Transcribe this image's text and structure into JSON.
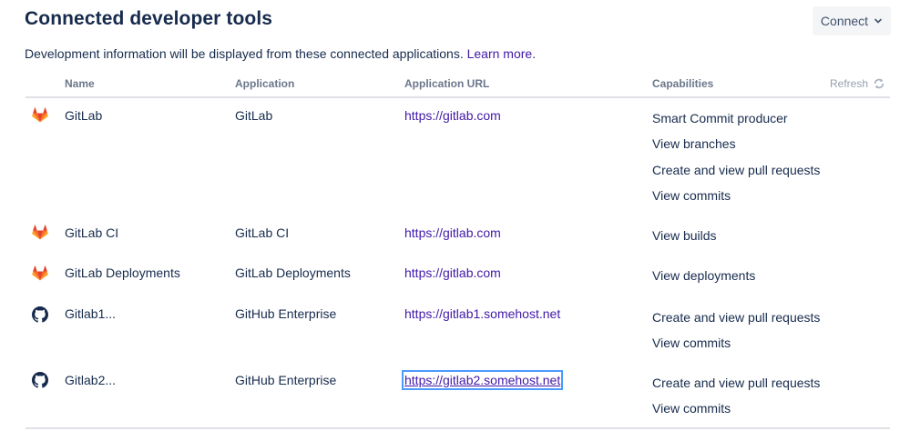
{
  "header": {
    "title": "Connected developer tools",
    "connect_label": "Connect",
    "description_text": "Development information will be displayed from these connected applications.",
    "learn_more": "Learn more",
    "learn_more_suffix": "."
  },
  "table": {
    "columns": {
      "name": "Name",
      "application": "Application",
      "url": "Application URL",
      "capabilities": "Capabilities"
    },
    "refresh_label": "Refresh",
    "rows": [
      {
        "icon": "gitlab-icon",
        "name": "GitLab",
        "application": "GitLab",
        "url": "https://gitlab.com",
        "capabilities": [
          "Smart Commit producer",
          "View branches",
          "Create and view pull requests",
          "View commits"
        ]
      },
      {
        "icon": "gitlab-icon",
        "name": "GitLab CI",
        "application": "GitLab CI",
        "url": "https://gitlab.com",
        "capabilities": [
          "View builds"
        ]
      },
      {
        "icon": "gitlab-icon",
        "name": "GitLab Deployments",
        "application": "GitLab Deployments",
        "url": "https://gitlab.com",
        "capabilities": [
          "View deployments"
        ]
      },
      {
        "icon": "github-icon",
        "name": "Gitlab1...",
        "application": "GitHub Enterprise",
        "url": "https://gitlab1.somehost.net",
        "capabilities": [
          "Create and view pull requests",
          "View commits"
        ]
      },
      {
        "icon": "github-icon",
        "name": "Gitlab2...",
        "application": "GitHub Enterprise",
        "url": "https://gitlab2.somehost.net",
        "capabilities": [
          "Create and view pull requests",
          "View commits"
        ]
      }
    ]
  },
  "colors": {
    "link": "#4118a8",
    "gitlab_orange": "#e24329",
    "header_text": "#6b778c"
  }
}
